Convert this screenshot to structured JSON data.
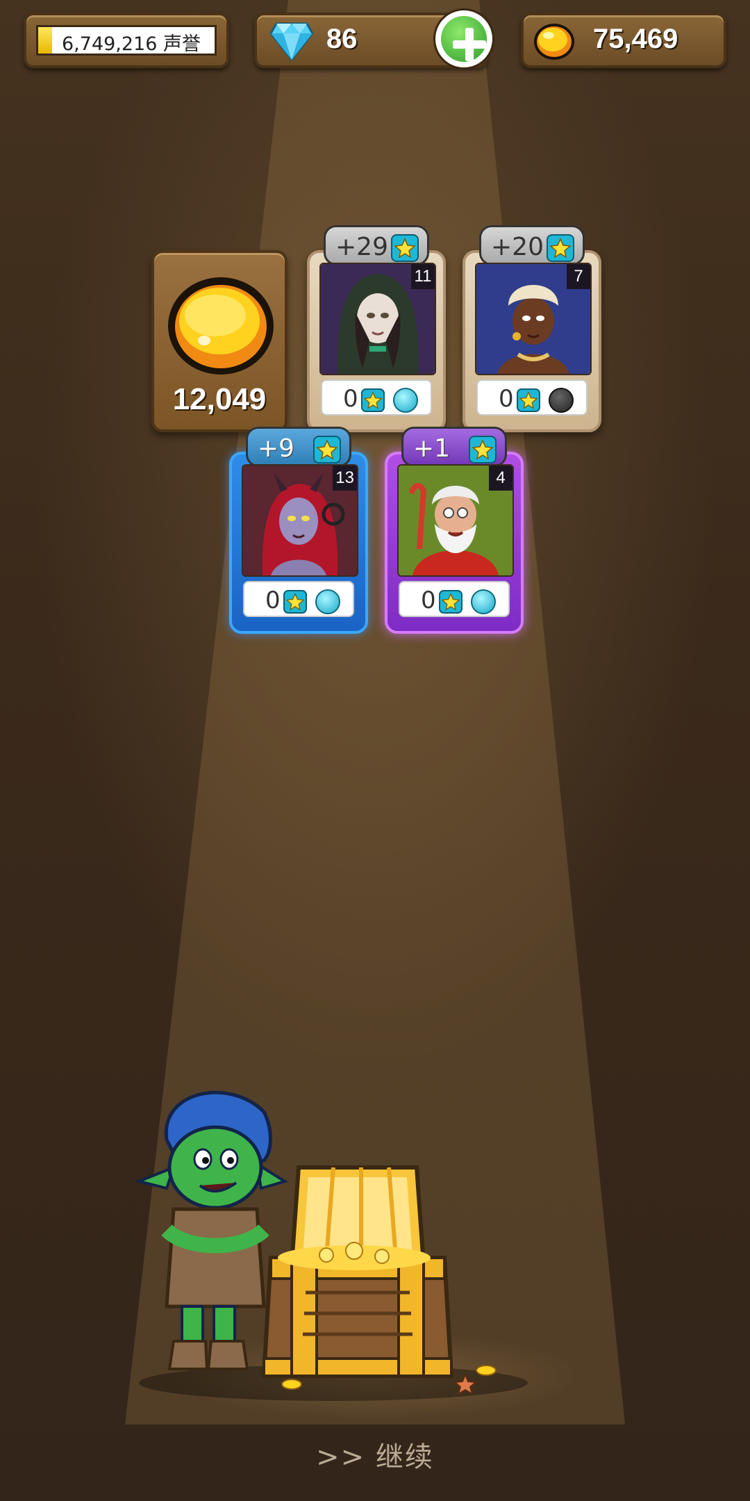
{
  "hud": {
    "reputation": {
      "text": "6,749,216 声誉",
      "progress": 0.08
    },
    "gems": {
      "count": "86",
      "add_icon": "plus-icon"
    },
    "gold": {
      "count": "75,469"
    }
  },
  "rewards": {
    "gold_amount": "12,049",
    "heroes": [
      {
        "badge": "+29",
        "level": "11",
        "stat_count": "0",
        "rarity": "common",
        "orb": "cyan-orb",
        "portrait": "hooded-woman"
      },
      {
        "badge": "+20",
        "level": "7",
        "stat_count": "0",
        "rarity": "common",
        "orb": "dark-orb",
        "portrait": "turban-woman"
      },
      {
        "badge": "+9",
        "level": "13",
        "stat_count": "0",
        "rarity": "rare",
        "orb": "cyan-orb",
        "portrait": "horned-demoness"
      },
      {
        "badge": "+1",
        "level": "4",
        "stat_count": "0",
        "rarity": "epic",
        "orb": "cyan-orb",
        "portrait": "bearded-santa"
      }
    ]
  },
  "continue_label": ">> 继续",
  "colors": {
    "background": "#3d2b1c",
    "panel": "#7c5526",
    "rare": "#2f8de6",
    "epic": "#b04ee6",
    "accent_star": "#1fb7d6"
  }
}
